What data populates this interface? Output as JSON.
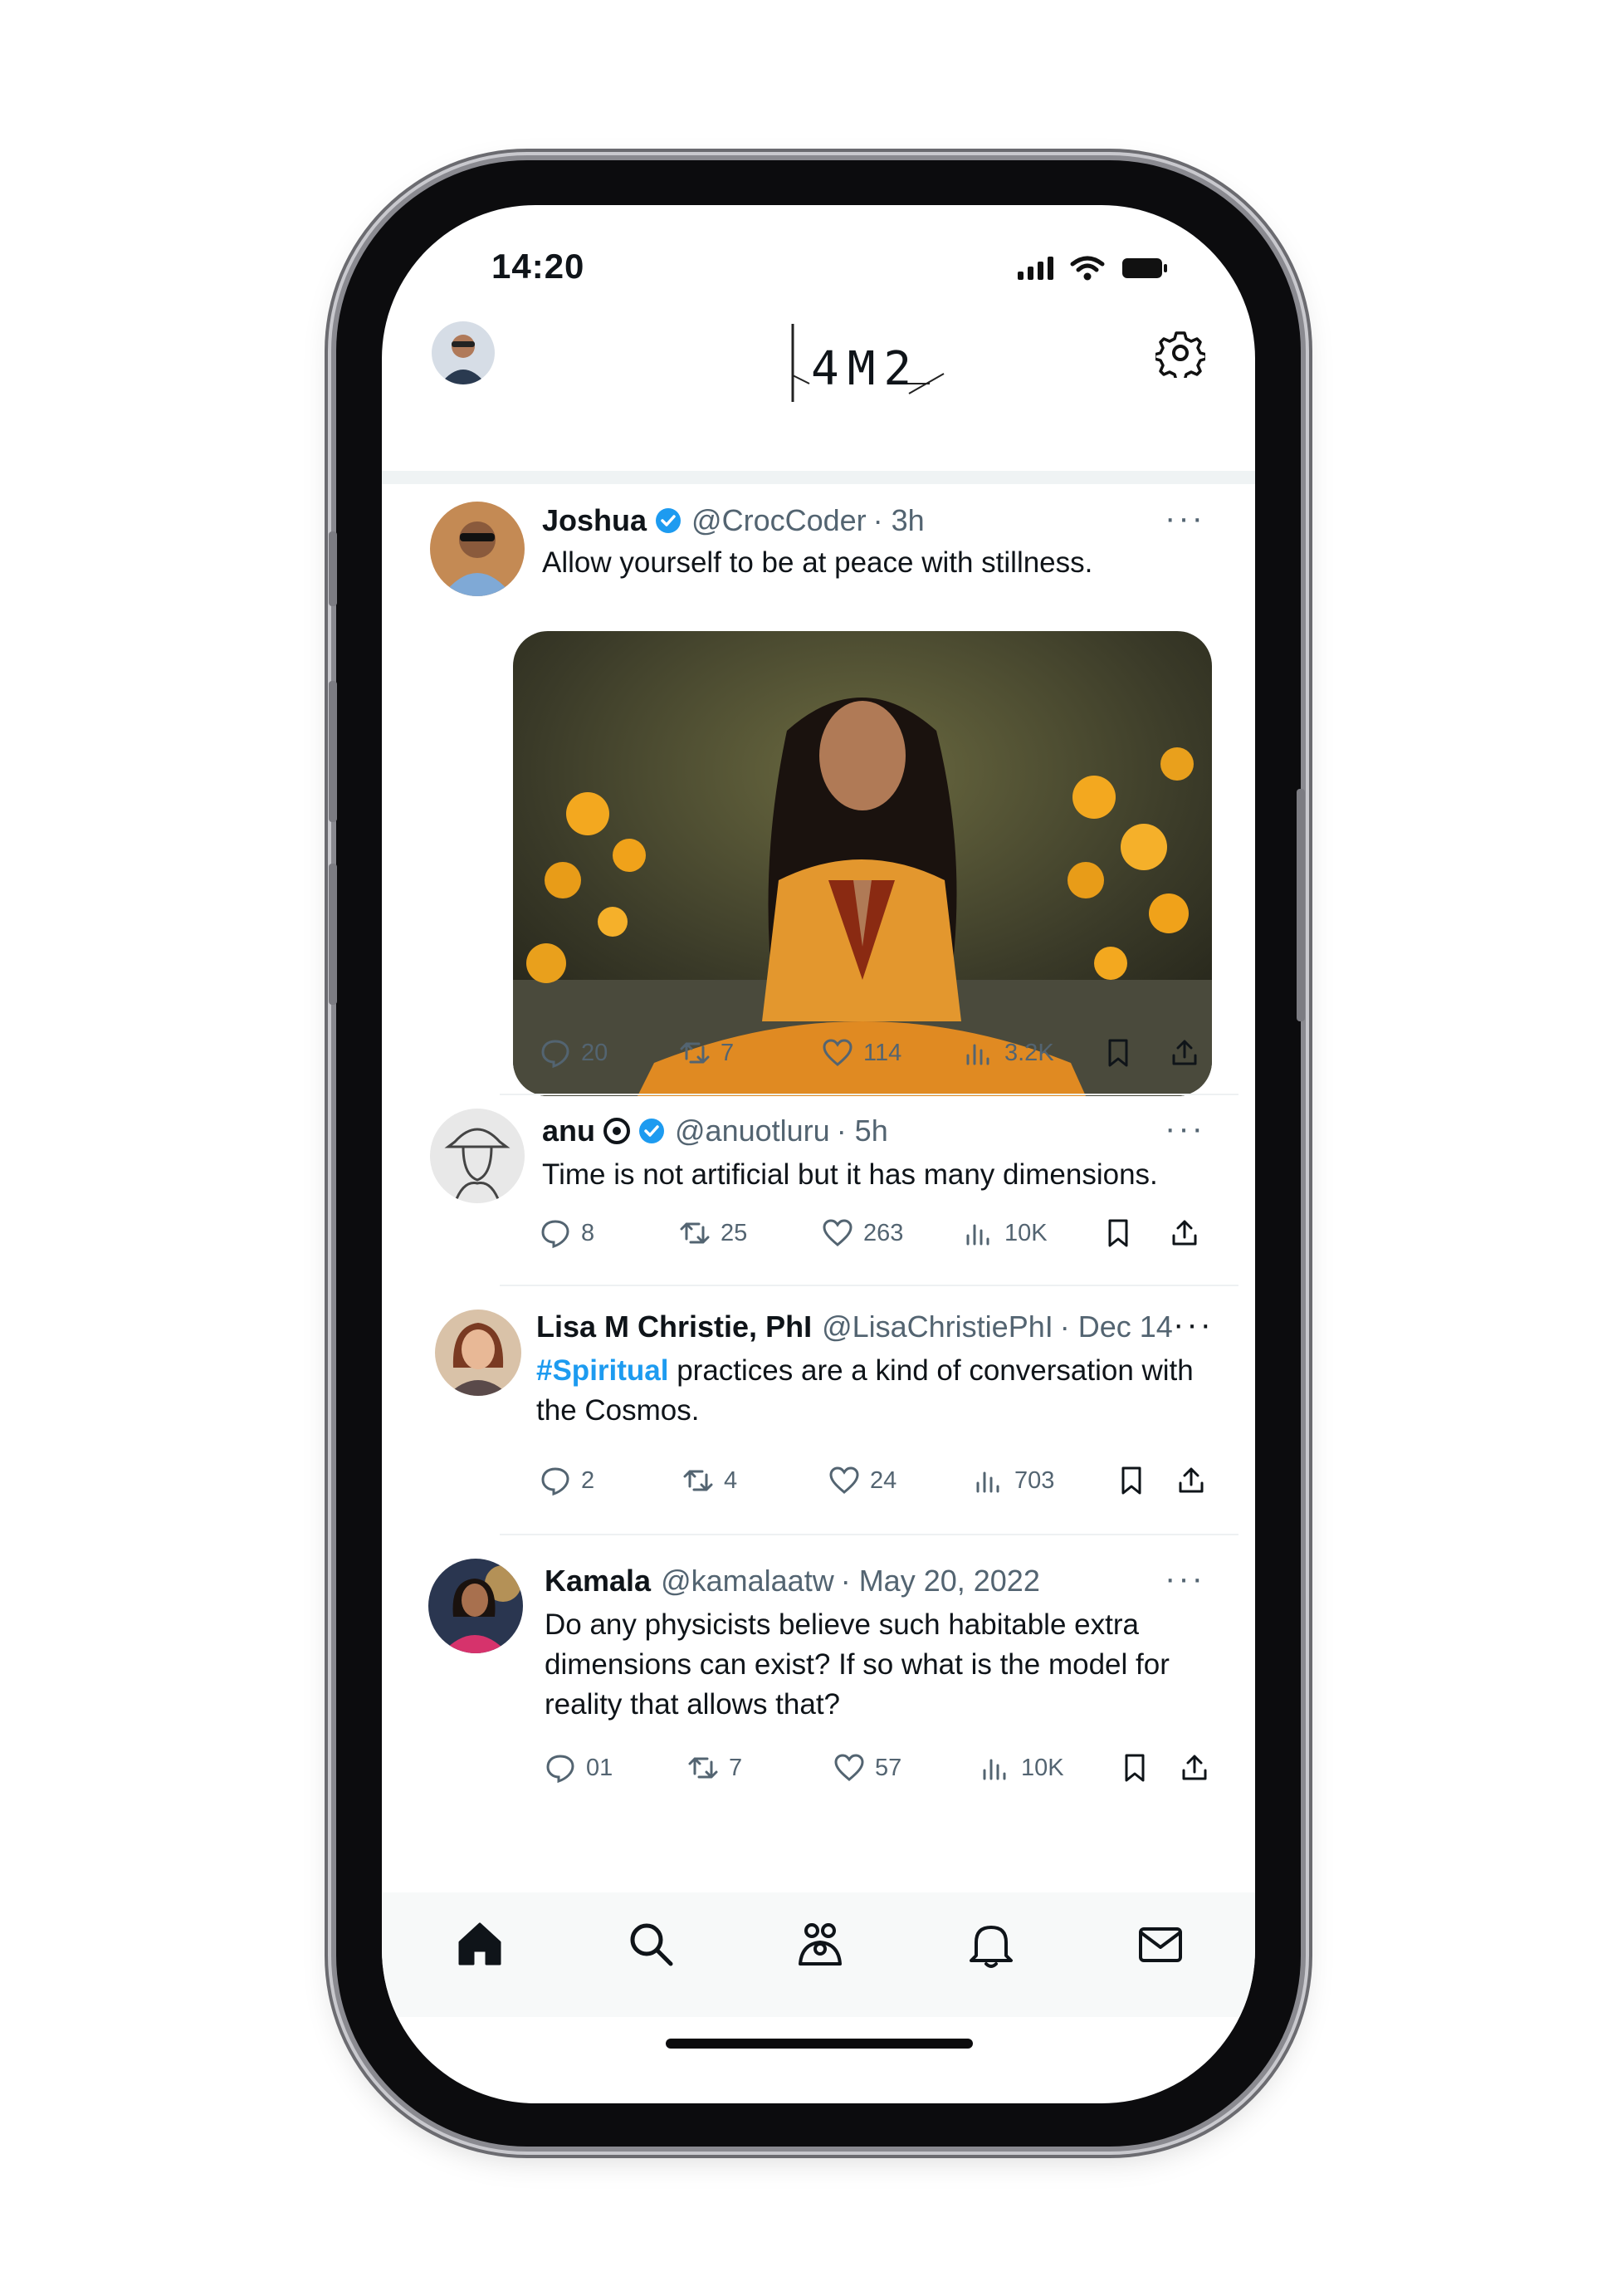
{
  "status_bar": {
    "time": "14:20"
  },
  "header": {
    "logo_text": "4M2"
  },
  "tweets": [
    {
      "name": "Joshua",
      "verified": true,
      "handle": "@CrocCoder",
      "time": "· 3h",
      "text": "Allow yourself to be at peace with stillness.",
      "has_media": true,
      "stats": {
        "replies": "20",
        "retweets": "7",
        "likes": "114",
        "views": "3.2K"
      }
    },
    {
      "name": "anu",
      "verified": true,
      "handle": "@anuotluru",
      "time": "· 5h",
      "text": "Time is not artificial but it has many dimensions.",
      "stats": {
        "replies": "8",
        "retweets": "25",
        "likes": "263",
        "views": "10K"
      }
    },
    {
      "name": "Lisa M Christie, PhI",
      "handle": "@LisaChristiePhI",
      "time": "· Dec 14",
      "hashtag": "#Spiritual",
      "text": "practices are a kind of conversation with the Cosmos.",
      "stats": {
        "replies": "2",
        "retweets": "4",
        "likes": "24",
        "views": "703"
      }
    },
    {
      "name": "Kamala",
      "handle": "@kamalaatw",
      "time": "· May 20, 2022",
      "text": "Do any physicists believe such habitable extra dimensions can exist? If so what is the model for reality that allows that?",
      "stats": {
        "replies": "01",
        "retweets": "7",
        "likes": "57",
        "views": "10K"
      }
    }
  ],
  "nav": [
    "home-icon",
    "search-icon",
    "communities-icon",
    "notifications-icon",
    "messages-icon"
  ],
  "colors": {
    "accent": "#1d9bf0",
    "text": "#0f1419",
    "muted": "#536471"
  }
}
